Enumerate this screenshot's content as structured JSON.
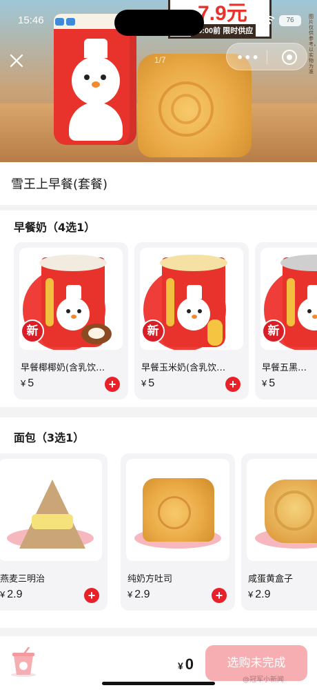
{
  "status_bar": {
    "time": "15:46",
    "battery": "76"
  },
  "hero": {
    "promo_price": "7.9元",
    "promo_caption": "10:00前 限时供应",
    "image_counter": "1/7",
    "fine_print": "图片仅供参考，以实物为准"
  },
  "product": {
    "title": "雪王上早餐(套餐)"
  },
  "milk_section": {
    "title": "早餐奶（4选1）",
    "items": [
      {
        "name": "早餐椰椰奶(含乳饮…",
        "currency": "¥",
        "price": "5",
        "badge": "新",
        "flavor": "coconut",
        "liquid_color": "#f1ecdf"
      },
      {
        "name": "早餐玉米奶(含乳饮…",
        "currency": "¥",
        "price": "5",
        "badge": "新",
        "flavor": "corn",
        "liquid_color": "#f4e1a3"
      },
      {
        "name": "早餐五黑…",
        "currency": "¥",
        "price": "5",
        "badge": "新",
        "flavor": "black",
        "liquid_color": "#cfcfcf"
      }
    ]
  },
  "bread_section": {
    "title": "面包（3选1）",
    "items": [
      {
        "name": "燕麦三明治",
        "currency": "¥",
        "price": "2.9",
        "kind": "sandwich"
      },
      {
        "name": "纯奶方吐司",
        "currency": "¥",
        "price": "2.9",
        "kind": "toast"
      },
      {
        "name": "咸蛋黄盒子",
        "currency": "¥",
        "price": "2.9",
        "kind": "eggbox"
      }
    ]
  },
  "bottom_bar": {
    "currency": "¥",
    "total": "0",
    "checkout_label": "选购未完成"
  },
  "watermark": "@冠军小新闻",
  "colors": {
    "brand_red": "#e7202a",
    "checkout_pink": "#f7aeb2"
  }
}
